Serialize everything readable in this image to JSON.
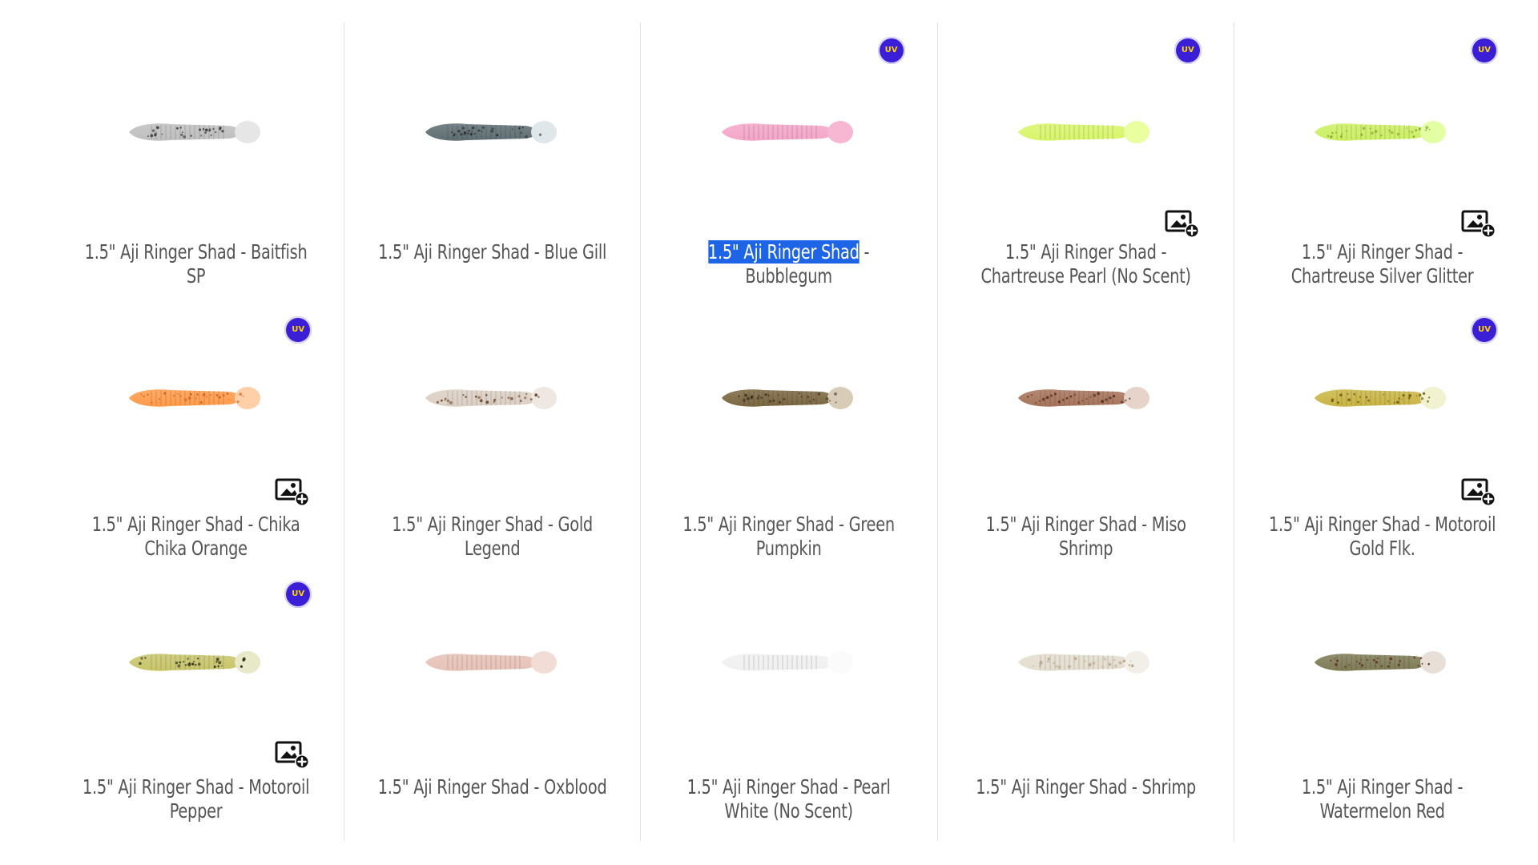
{
  "colors": {
    "uv_badge": "#3b1fd6",
    "selection": "#1e64e6",
    "caption_text": "#555555"
  },
  "badge_text": "UV",
  "products": [
    {
      "prefix": "1.5\" Aji Ringer Shad",
      "rest": " - Baitfish SP",
      "uv": false,
      "add_image": false,
      "highlight": false,
      "body": "#bfbfbf",
      "speckle": "#333333",
      "tail": "#e6e6e6"
    },
    {
      "prefix": "1.5\" Aji Ringer Shad",
      "rest": " - Blue Gill",
      "uv": false,
      "add_image": false,
      "highlight": false,
      "body": "#5e6e72",
      "speckle": "#2b2b2b",
      "tail": "#dfe7ea"
    },
    {
      "prefix": "1.5\" Aji Ringer Shad",
      "rest": " - Bubblegum",
      "uv": true,
      "add_image": false,
      "highlight": true,
      "body": "#f4a6c8",
      "speckle": "#f4a6c8",
      "tail": "#f7b7d2"
    },
    {
      "prefix": "1.5\" Aji Ringer Shad",
      "rest": " - Chartreuse Pearl (No Scent)",
      "uv": true,
      "add_image": true,
      "highlight": false,
      "body": "#d8f56a",
      "speckle": "#d8f56a",
      "tail": "#e9ffa0"
    },
    {
      "prefix": "1.5\" Aji Ringer Shad",
      "rest": " - Chartreuse Silver Glitter",
      "uv": true,
      "add_image": true,
      "highlight": false,
      "body": "#ccef62",
      "speckle": "#8aa13a",
      "tail": "#e3ffa3"
    },
    {
      "prefix": "1.5\" Aji Ringer Shad",
      "rest": " - Chika Chika Orange",
      "uv": true,
      "add_image": true,
      "highlight": false,
      "body": "#ff9b4a",
      "speckle": "#cc5a1a",
      "tail": "#ffd0a8"
    },
    {
      "prefix": "1.5\" Aji Ringer Shad",
      "rest": " - Gold Legend",
      "uv": false,
      "add_image": false,
      "highlight": false,
      "body": "#dccfc4",
      "speckle": "#6b4a2b",
      "tail": "#efe7e1"
    },
    {
      "prefix": "1.5\" Aji Ringer Shad",
      "rest": " - Green Pumpkin",
      "uv": false,
      "add_image": false,
      "highlight": false,
      "body": "#7a6640",
      "speckle": "#3b2f1b",
      "tail": "#d8cbb7"
    },
    {
      "prefix": "1.5\" Aji Ringer Shad",
      "rest": " - Miso Shrimp",
      "uv": false,
      "add_image": false,
      "highlight": false,
      "body": "#a7735a",
      "speckle": "#4b2b1d",
      "tail": "#e6d3c9"
    },
    {
      "prefix": "1.5\" Aji Ringer Shad",
      "rest": " - Motoroil Gold Flk.",
      "uv": true,
      "add_image": true,
      "highlight": false,
      "body": "#c9b544",
      "speckle": "#6d5a14",
      "tail": "#f0f2d0"
    },
    {
      "prefix": "1.5\" Aji Ringer Shad",
      "rest": " - Motoroil Pepper",
      "uv": true,
      "add_image": true,
      "highlight": false,
      "body": "#c8c56a",
      "speckle": "#2b2b16",
      "tail": "#e7e9c9"
    },
    {
      "prefix": "1.5\" Aji Ringer Shad",
      "rest": " - Oxblood",
      "uv": false,
      "add_image": false,
      "highlight": false,
      "body": "#e7c2b6",
      "speckle": "#e7c2b6",
      "tail": "#f2ddd6"
    },
    {
      "prefix": "1.5\" Aji Ringer Shad",
      "rest": " - Pearl White (No Scent)",
      "uv": false,
      "add_image": false,
      "highlight": false,
      "body": "#f0f0f0",
      "speckle": "#f0f0f0",
      "tail": "#fbfbfb"
    },
    {
      "prefix": "1.5\" Aji Ringer Shad",
      "rest": " - Shrimp",
      "uv": false,
      "add_image": false,
      "highlight": false,
      "body": "#e4ddcf",
      "speckle": "#b9a98f",
      "tail": "#f2efe8"
    },
    {
      "prefix": "1.5\" Aji Ringer Shad",
      "rest": " - Watermelon Red",
      "uv": false,
      "add_image": false,
      "highlight": false,
      "body": "#7e7b55",
      "speckle": "#5a2b22",
      "tail": "#e8dfd8"
    }
  ]
}
